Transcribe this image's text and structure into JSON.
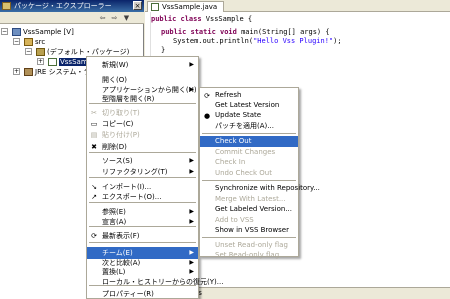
{
  "explorer": {
    "title": "パッケージ・エクスプローラー",
    "close_glyph": "×",
    "toolbar_glyphs": [
      "⇦",
      "⇨",
      "▼"
    ],
    "tree": {
      "project": "VssSample [V]",
      "src": "src",
      "package": "(デフォルト・パッケージ)",
      "file": "VssSample",
      "jre": "JRE システム・ライブ",
      "expanded_glyph": "−",
      "collapsed_glyph": "+"
    }
  },
  "editor": {
    "tab_label": "VssSample.java",
    "code": {
      "line1_kw": "public class",
      "line1_rest": " VssSample {",
      "line2_kw": "public static void",
      "line2_rest": " main(String[] args) {",
      "line3_pre": "System.out.println(",
      "line3_str": "\"Hello Vss Plugin!\"",
      "line3_post": ");",
      "line4": "}"
    }
  },
  "bottom_strip_text": "les",
  "context_menu": {
    "items": [
      {
        "label": "新規(W)",
        "submenu": true
      },
      {
        "label": "開く(O)"
      },
      {
        "label": "アプリケーションから開く(H)",
        "submenu": true
      },
      {
        "label": "型階層を開く(R)"
      },
      {
        "label": "切り取り(T)",
        "disabled": true,
        "icon": "✂"
      },
      {
        "label": "コピー(C)",
        "icon": "▭"
      },
      {
        "label": "貼り付け(P)",
        "disabled": true,
        "icon": "▤"
      },
      {
        "label": "削除(D)",
        "icon": "✖"
      },
      {
        "label": "ソース(S)",
        "submenu": true
      },
      {
        "label": "リファクタリング(T)",
        "submenu": true
      },
      {
        "label": "インポート(I)...",
        "icon": "↘"
      },
      {
        "label": "エクスポート(O)...",
        "icon": "↗"
      },
      {
        "label": "参照(E)",
        "submenu": true
      },
      {
        "label": "宣言(A)",
        "submenu": true
      },
      {
        "label": "最新表示(F)",
        "icon": "⟳"
      },
      {
        "label": "チーム(E)",
        "submenu": true,
        "highlighted": true
      },
      {
        "label": "次と比較(A)",
        "submenu": true
      },
      {
        "label": "置換(L)",
        "submenu": true
      },
      {
        "label": "ローカル・ヒストリーからの復元(Y)..."
      },
      {
        "label": "プロパティー(R)"
      }
    ],
    "submenu_arrow": "▶"
  },
  "team_submenu": {
    "items": [
      {
        "label": "Refresh",
        "icon": "⟳"
      },
      {
        "label": "Get Latest Version"
      },
      {
        "label": "Update State",
        "icon": "●"
      },
      {
        "label": "パッチを適用(A)..."
      },
      {
        "label": "Check Out",
        "highlighted": true
      },
      {
        "label": "Commit Changes",
        "disabled": true
      },
      {
        "label": "Check In",
        "disabled": true
      },
      {
        "label": "Undo Check Out",
        "disabled": true
      },
      {
        "label": "Synchronize with Repository..."
      },
      {
        "label": "Merge With Latest...",
        "disabled": true
      },
      {
        "label": "Get Labeled Version..."
      },
      {
        "label": "Add to VSS",
        "disabled": true
      },
      {
        "label": "Show in VSS Browser"
      },
      {
        "label": "Unset Read-only flag",
        "disabled": true
      },
      {
        "label": "Set Read-only flag",
        "disabled": true
      }
    ]
  },
  "colors": {
    "title_bar": "#0a246a",
    "menu_highlight": "#316ac5",
    "keyword": "#7f0055",
    "string": "#2a00ff"
  }
}
